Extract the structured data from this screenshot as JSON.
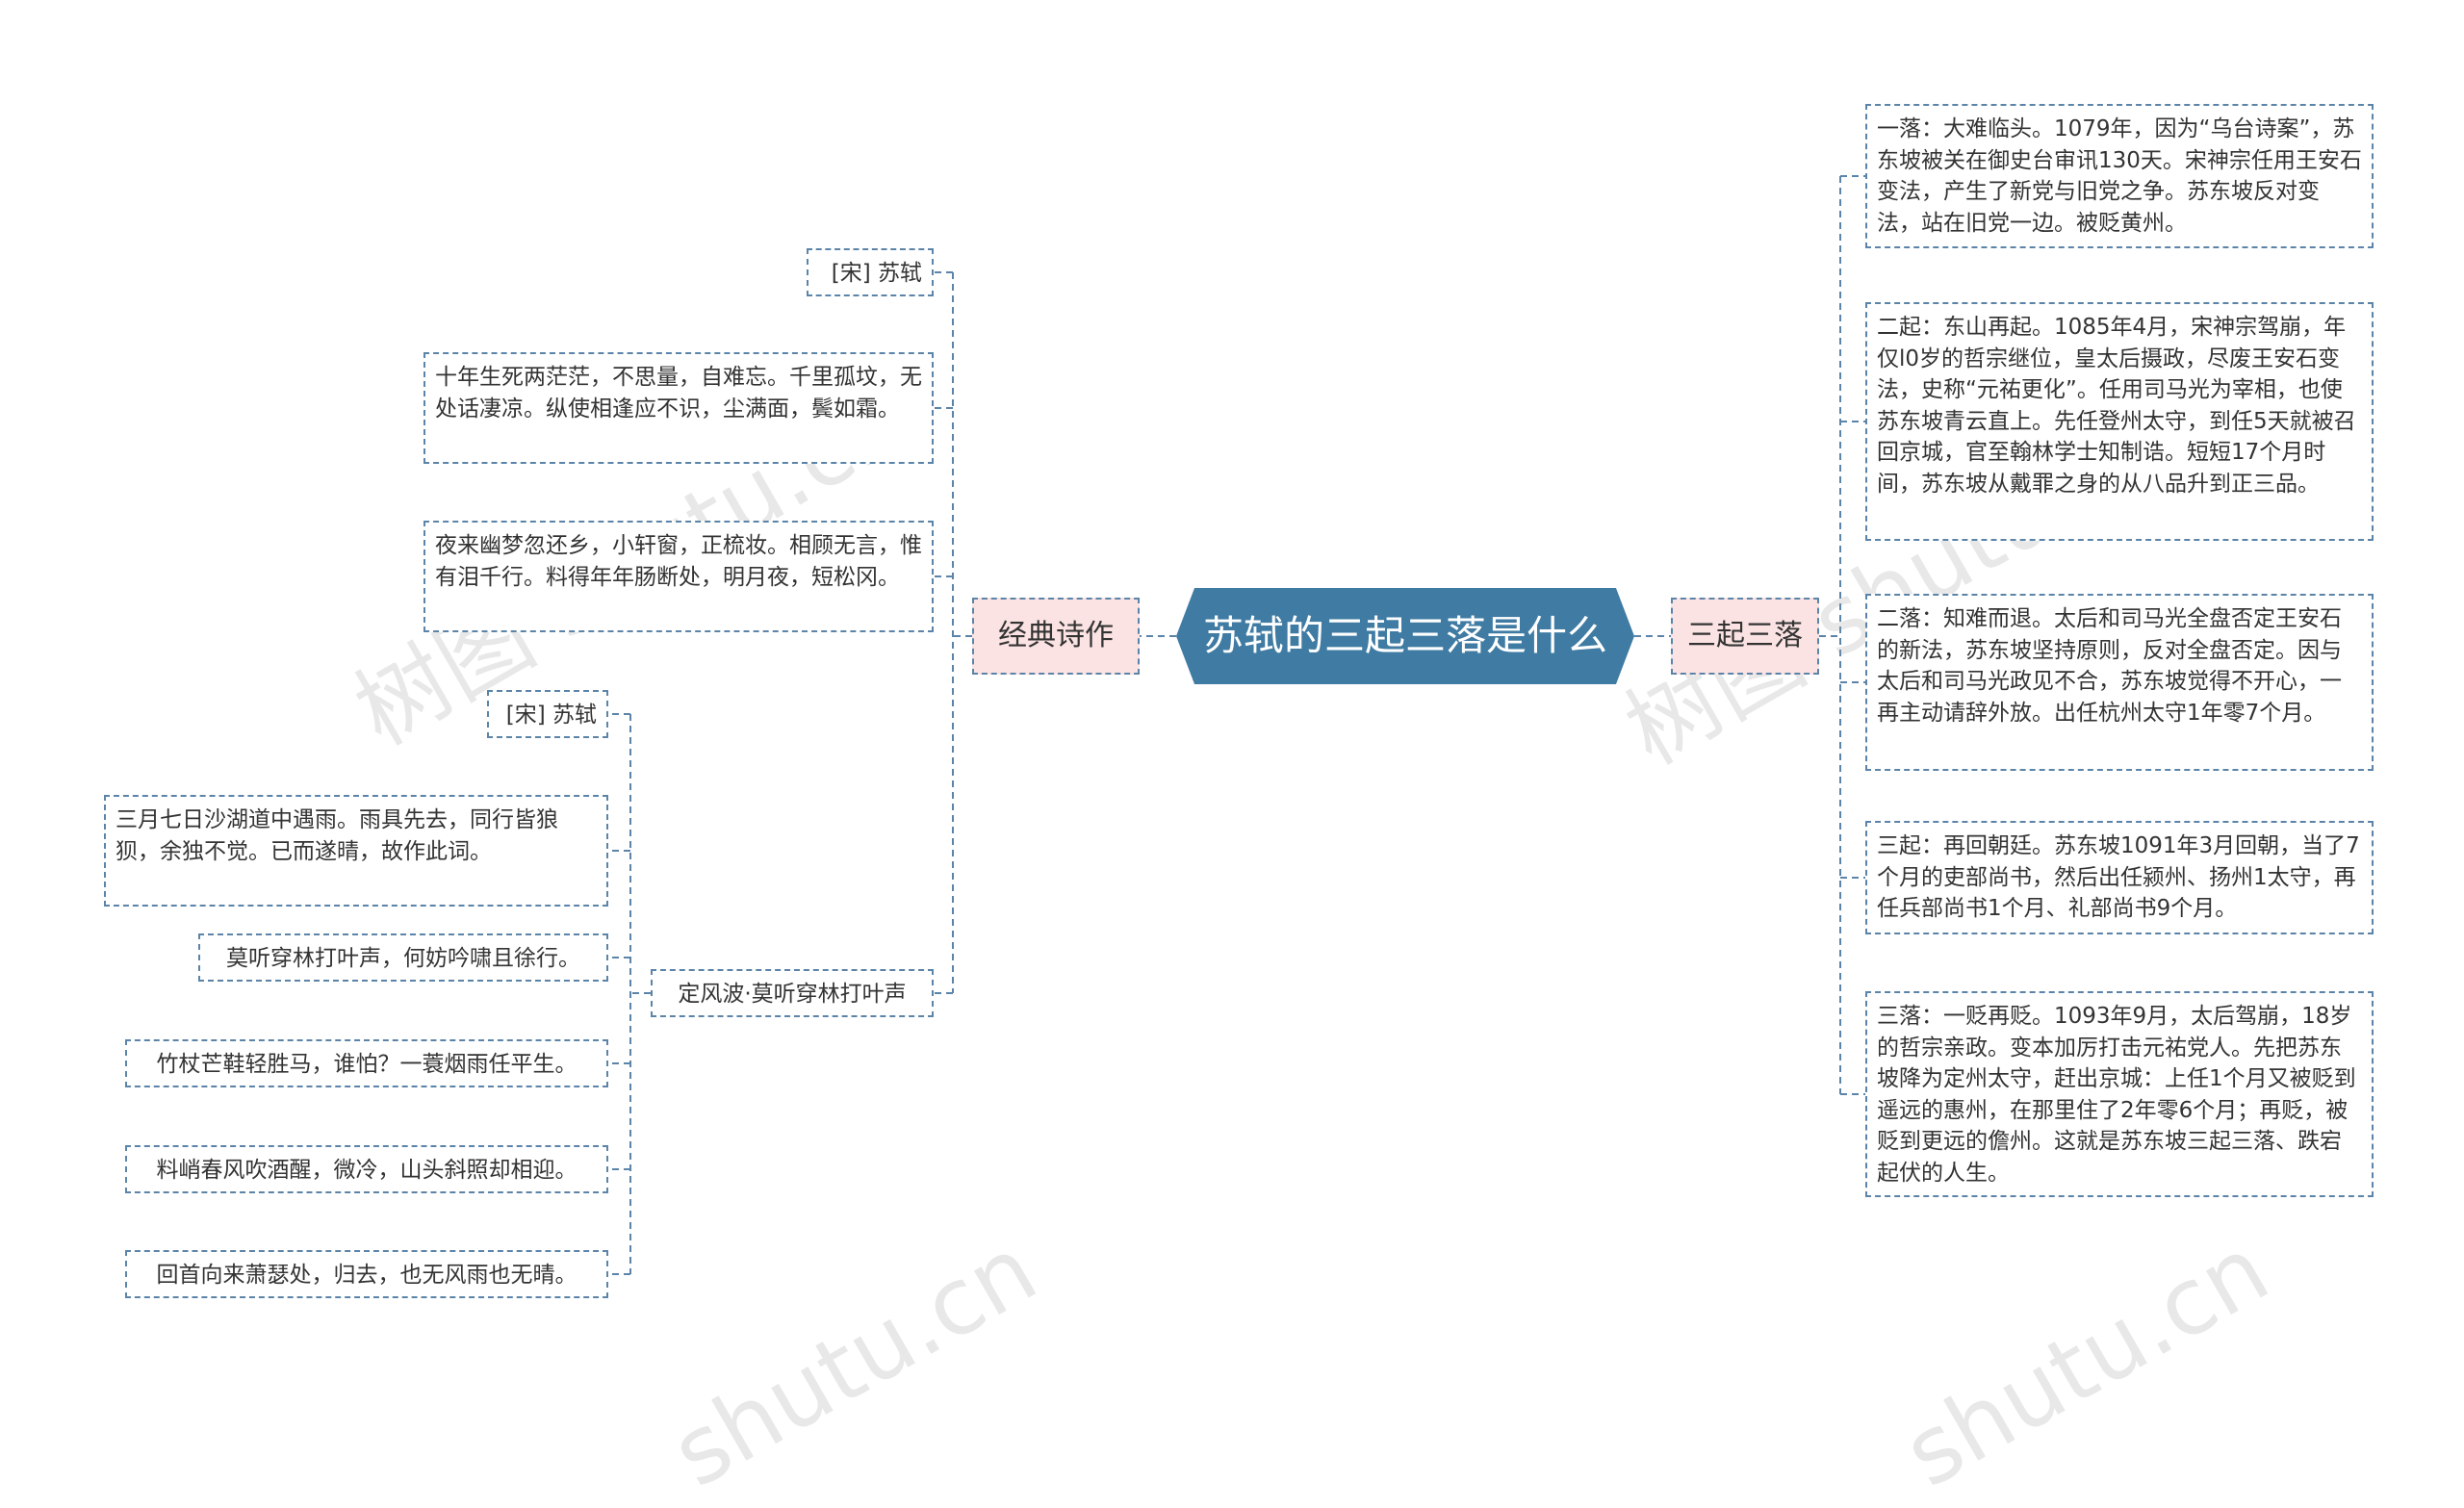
{
  "root": {
    "label": "苏轼的三起三落是什么"
  },
  "left_branch": {
    "label": "经典诗作",
    "poem1": {
      "author": "[宋] 苏轼",
      "lines": [
        "十年生死两茫茫，不思量，自难忘。千里孤坟，无处话凄凉。纵使相逢应不识，尘满面，鬓如霜。",
        "夜来幽梦忽还乡，小轩窗，正梳妆。相顾无言，惟有泪千行。料得年年肠断处，明月夜，短松冈。"
      ]
    },
    "poem2": {
      "title": "定风波·莫听穿林打叶声",
      "author": "[宋] 苏轼",
      "lines": [
        "三月七日沙湖道中遇雨。雨具先去，同行皆狼狈，余独不觉。已而遂晴，故作此词。",
        "莫听穿林打叶声，何妨吟啸且徐行。",
        "竹杖芒鞋轻胜马，谁怕？一蓑烟雨任平生。",
        "料峭春风吹酒醒，微冷，山头斜照却相迎。",
        "回首向来萧瑟处，归去，也无风雨也无晴。"
      ]
    }
  },
  "right_branch": {
    "label": "三起三落",
    "items": [
      "一落：大难临头。1079年，因为“乌台诗案”，苏东坡被关在御史台审讯130天。宋神宗任用王安石变法，产生了新党与旧党之争。苏东坡反对变法，站在旧党一边。被贬黄州。",
      "二起：东山再起。1085年4月，宋神宗驾崩，年仅l0岁的哲宗继位，皇太后摄政，尽废王安石变法，史称“元祐更化”。任用司马光为宰相，也使苏东坡青云直上。先任登州太守，到任5天就被召回京城，官至翰林学士知制诰。短短17个月时间，苏东坡从戴罪之身的从八品升到正三品。",
      "二落：知难而退。太后和司马光全盘否定王安石的新法，苏东坡坚持原则，反对全盘否定。因与太后和司马光政见不合，苏东坡觉得不开心，一再主动请辞外放。出任杭州太守1年零7个月。",
      "三起：再回朝廷。苏东坡1091年3月回朝，当了7个月的吏部尚书，然后出任颍州、扬州1太守，再任兵部尚书1个月、礼部尚书9个月。",
      "三落：一贬再贬。1093年9月，太后驾崩，18岁的哲宗亲政。变本加厉打击元祐党人。先把苏东坡降为定州太守，赶出京城：上任1个月又被贬到遥远的惠州，在那里住了2年零6个月；再贬，被贬到更远的儋州。这就是苏东坡三起三落、跌宕起伏的人生。"
    ]
  },
  "watermark": {
    "text_1": "树图 shutu.cn",
    "text_2": "树图 shutu.cn",
    "text_3": "shutu.cn",
    "text_4": "shutu.cn"
  },
  "colors": {
    "root_bg": "#3f7ba3",
    "branch_bg": "#fbe3e3",
    "line": "#5b84a8"
  }
}
